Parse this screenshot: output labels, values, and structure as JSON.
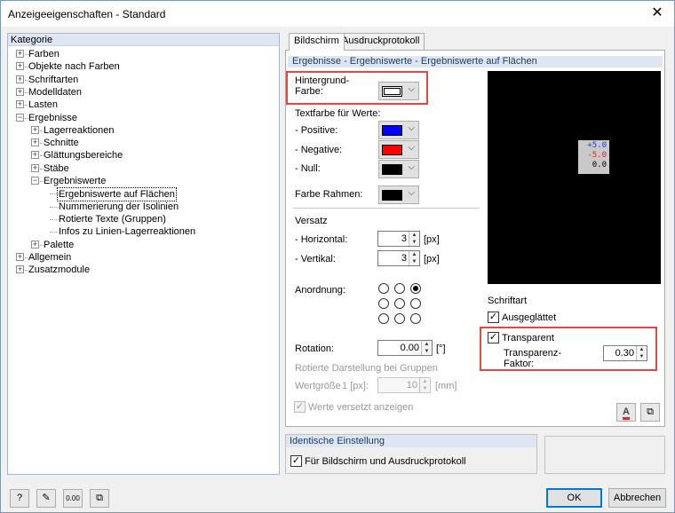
{
  "window": {
    "title": "Anzeigeeigenschaften - Standard"
  },
  "category": {
    "header": "Kategorie",
    "tree": [
      {
        "label": "Farben",
        "level": 0,
        "expander": "+"
      },
      {
        "label": "Objekte nach Farben",
        "level": 0,
        "expander": "+"
      },
      {
        "label": "Schriftarten",
        "level": 0,
        "expander": "+"
      },
      {
        "label": "Modelldaten",
        "level": 0,
        "expander": "+"
      },
      {
        "label": "Lasten",
        "level": 0,
        "expander": "+"
      },
      {
        "label": "Ergebnisse",
        "level": 0,
        "expander": "-"
      },
      {
        "label": "Lagerreaktionen",
        "level": 1,
        "expander": "+"
      },
      {
        "label": "Schnitte",
        "level": 1,
        "expander": "+"
      },
      {
        "label": "Glättungsbereiche",
        "level": 1,
        "expander": "+"
      },
      {
        "label": "Stäbe",
        "level": 1,
        "expander": "+"
      },
      {
        "label": "Ergebniswerte",
        "level": 1,
        "expander": "-"
      },
      {
        "label": "Ergebniswerte auf Flächen",
        "level": 2,
        "expander": "",
        "selected": true
      },
      {
        "label": "Nummerierung der Isolinien",
        "level": 2,
        "expander": ""
      },
      {
        "label": "Rotierte Texte (Gruppen)",
        "level": 2,
        "expander": ""
      },
      {
        "label": "Infos zu Linien-Lagerreaktionen",
        "level": 2,
        "expander": ""
      },
      {
        "label": "Palette",
        "level": 1,
        "expander": "+"
      },
      {
        "label": "Allgemein",
        "level": 0,
        "expander": "+"
      },
      {
        "label": "Zusatzmodule",
        "level": 0,
        "expander": "+"
      }
    ]
  },
  "tabs": {
    "screen": "Bildschirm",
    "print": "Ausdruckprotokoll"
  },
  "section_title": "Ergebnisse - Ergebniswerte - Ergebniswerte auf Flächen",
  "background": {
    "label_line1": "Hintergrund-",
    "label_line2": "Farbe:",
    "color": "#ffffff"
  },
  "text_colors": {
    "heading": "Textfarbe für Werte:",
    "positive_label": "- Positive:",
    "positive_color": "#0000ff",
    "negative_label": "- Negative:",
    "negative_color": "#ff0000",
    "null_label": "- Null:",
    "null_color": "#000000"
  },
  "frame": {
    "label": "Farbe Rahmen:",
    "color": "#000000"
  },
  "offset": {
    "heading": "Versatz",
    "horizontal_label": "- Horizontal:",
    "horizontal_value": "3",
    "vertical_label": "- Vertikal:",
    "vertical_value": "3",
    "unit": "[px]"
  },
  "arrangement": {
    "label": "Anordnung:",
    "selected": 2
  },
  "rotation": {
    "label": "Rotation:",
    "value": "0.00",
    "unit": "[°]"
  },
  "group_rotation": {
    "label": "Rotierte Darstellung bei Gruppen",
    "size_label": "Wertgröße",
    "px_value": "1 [px]:",
    "mm_value": "10",
    "mm_unit": "[mm]",
    "offset_check_label": "Werte versetzt anzeigen"
  },
  "preview": {
    "positive": "+5.0",
    "negative": "-5.0",
    "zero": "0.0"
  },
  "font": {
    "heading": "Schriftart",
    "smooth_label": "Ausgeglättet",
    "smooth_checked": true,
    "transparent_label": "Transparent",
    "transparent_checked": true,
    "factor_label_line1": "Transparenz-",
    "factor_label_line2": "Faktor:",
    "factor_value": "0.30"
  },
  "identical": {
    "heading": "Identische Einstellung",
    "check_label": "Für Bildschirm und Ausdruckprotokoll",
    "checked": true
  },
  "footer": {
    "ok": "OK",
    "cancel": "Abbrechen",
    "icon_num": "0.00"
  },
  "highlight_color": "#e04848"
}
